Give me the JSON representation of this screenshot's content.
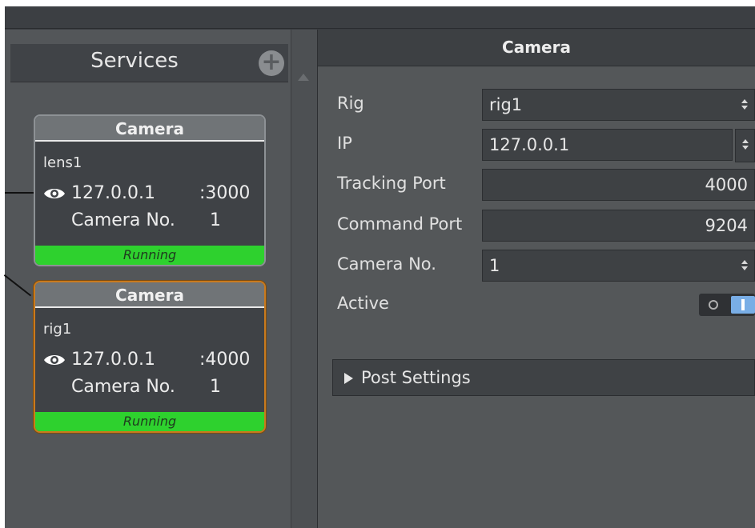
{
  "services": {
    "title": "Services",
    "add_icon": "plus-circle-icon",
    "cards": [
      {
        "header": "Camera",
        "name": "lens1",
        "ip": "127.0.0.1",
        "port": ":3000",
        "camera_label": "Camera No.",
        "camera_no": "1",
        "status": "Running",
        "selected": false
      },
      {
        "header": "Camera",
        "name": "rig1",
        "ip": "127.0.0.1",
        "port": ":4000",
        "camera_label": "Camera No.",
        "camera_no": "1",
        "status": "Running",
        "selected": true
      }
    ]
  },
  "properties": {
    "title": "Camera",
    "rows": {
      "rig": {
        "label": "Rig",
        "value": "rig1"
      },
      "ip": {
        "label": "IP",
        "value": "127.0.0.1"
      },
      "tracking_port": {
        "label": "Tracking Port",
        "value": "4000"
      },
      "command_port": {
        "label": "Command Port",
        "value": "9204"
      },
      "camera_no": {
        "label": "Camera No.",
        "value": "1"
      },
      "active": {
        "label": "Active",
        "value": true
      }
    },
    "post_settings": "Post Settings"
  },
  "colors": {
    "status_running": "#2ed12e",
    "selected_border": "#c97a1e",
    "toggle_on": "#79aee6"
  }
}
